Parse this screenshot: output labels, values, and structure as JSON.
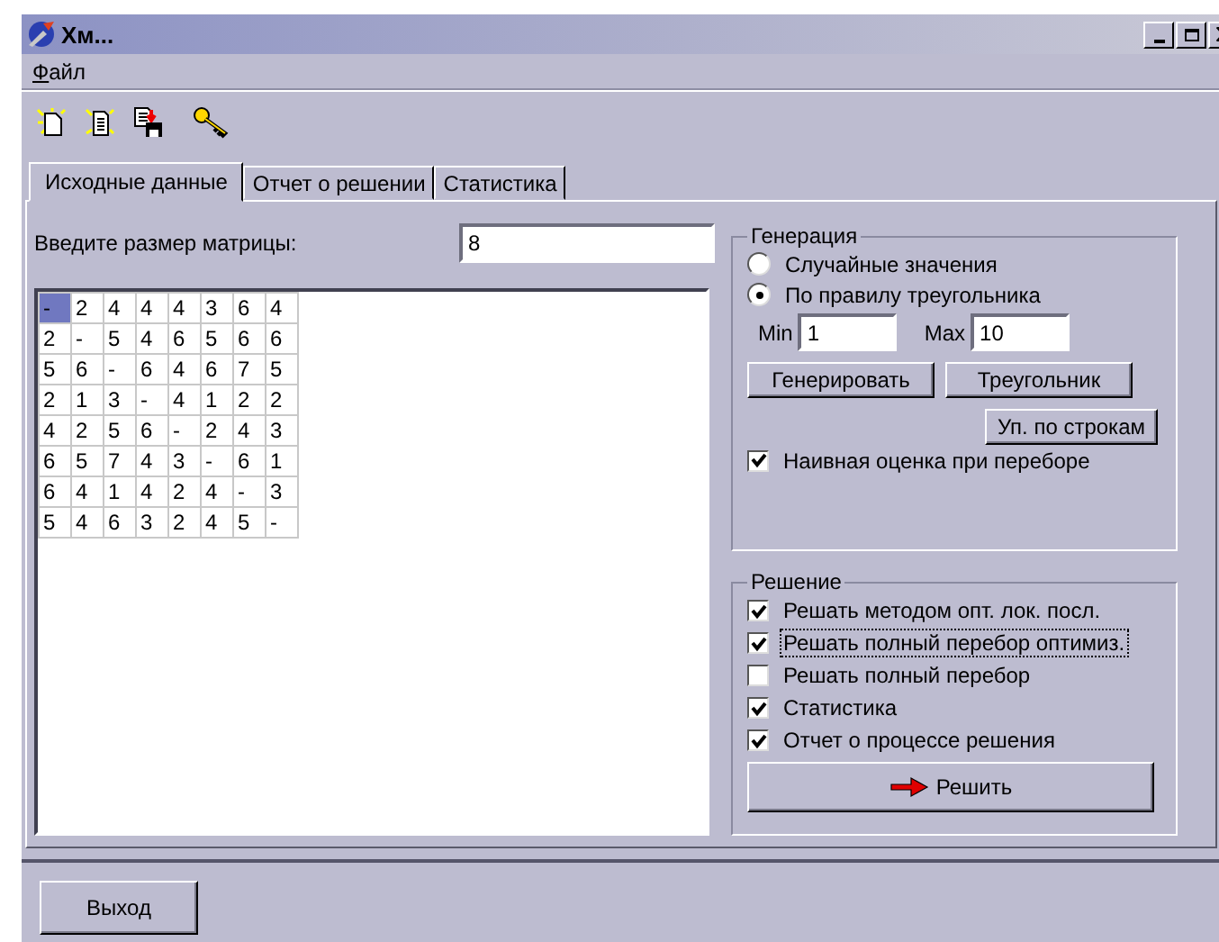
{
  "window": {
    "title": "Хм..."
  },
  "menu": [
    {
      "label": "Файл"
    }
  ],
  "tabs": [
    {
      "label": "Исходные данные",
      "selected": true
    },
    {
      "label": "Отчет о решении",
      "selected": false
    },
    {
      "label": "Статистика",
      "selected": false
    }
  ],
  "size_label": "Введите размер матрицы:",
  "size_field": {
    "value": "8"
  },
  "matrix": [
    {
      "cells": [
        {
          "text": "-",
          "selected": true
        },
        {
          "text": "2",
          "selected": false
        },
        {
          "text": "4",
          "selected": false
        },
        {
          "text": "4",
          "selected": false
        },
        {
          "text": "4",
          "selected": false
        },
        {
          "text": "3",
          "selected": false
        },
        {
          "text": "6",
          "selected": false
        },
        {
          "text": "4",
          "selected": false
        }
      ]
    },
    {
      "cells": [
        {
          "text": "2",
          "selected": false
        },
        {
          "text": "-",
          "selected": false
        },
        {
          "text": "5",
          "selected": false
        },
        {
          "text": "4",
          "selected": false
        },
        {
          "text": "6",
          "selected": false
        },
        {
          "text": "5",
          "selected": false
        },
        {
          "text": "6",
          "selected": false
        },
        {
          "text": "6",
          "selected": false
        }
      ]
    },
    {
      "cells": [
        {
          "text": "5",
          "selected": false
        },
        {
          "text": "6",
          "selected": false
        },
        {
          "text": "-",
          "selected": false
        },
        {
          "text": "6",
          "selected": false
        },
        {
          "text": "4",
          "selected": false
        },
        {
          "text": "6",
          "selected": false
        },
        {
          "text": "7",
          "selected": false
        },
        {
          "text": "5",
          "selected": false
        }
      ]
    },
    {
      "cells": [
        {
          "text": "2",
          "selected": false
        },
        {
          "text": "1",
          "selected": false
        },
        {
          "text": "3",
          "selected": false
        },
        {
          "text": "-",
          "selected": false
        },
        {
          "text": "4",
          "selected": false
        },
        {
          "text": "1",
          "selected": false
        },
        {
          "text": "2",
          "selected": false
        },
        {
          "text": "2",
          "selected": false
        }
      ]
    },
    {
      "cells": [
        {
          "text": "4",
          "selected": false
        },
        {
          "text": "2",
          "selected": false
        },
        {
          "text": "5",
          "selected": false
        },
        {
          "text": "6",
          "selected": false
        },
        {
          "text": "-",
          "selected": false
        },
        {
          "text": "2",
          "selected": false
        },
        {
          "text": "4",
          "selected": false
        },
        {
          "text": "3",
          "selected": false
        }
      ]
    },
    {
      "cells": [
        {
          "text": "6",
          "selected": false
        },
        {
          "text": "5",
          "selected": false
        },
        {
          "text": "7",
          "selected": false
        },
        {
          "text": "4",
          "selected": false
        },
        {
          "text": "3",
          "selected": false
        },
        {
          "text": "-",
          "selected": false
        },
        {
          "text": "6",
          "selected": false
        },
        {
          "text": "1",
          "selected": false
        }
      ]
    },
    {
      "cells": [
        {
          "text": "6",
          "selected": false
        },
        {
          "text": "4",
          "selected": false
        },
        {
          "text": "1",
          "selected": false
        },
        {
          "text": "4",
          "selected": false
        },
        {
          "text": "2",
          "selected": false
        },
        {
          "text": "4",
          "selected": false
        },
        {
          "text": "-",
          "selected": false
        },
        {
          "text": "3",
          "selected": false
        }
      ]
    },
    {
      "cells": [
        {
          "text": "5",
          "selected": false
        },
        {
          "text": "4",
          "selected": false
        },
        {
          "text": "6",
          "selected": false
        },
        {
          "text": "3",
          "selected": false
        },
        {
          "text": "2",
          "selected": false
        },
        {
          "text": "4",
          "selected": false
        },
        {
          "text": "5",
          "selected": false
        },
        {
          "text": "-",
          "selected": false
        }
      ]
    }
  ],
  "generation": {
    "title": "Генерация",
    "options": [
      {
        "label": "Случайные значения",
        "selected": false
      },
      {
        "label": "По правилу треугольника",
        "selected": true
      }
    ],
    "min": {
      "label": "Min",
      "value": "1"
    },
    "max": {
      "label": "Max",
      "value": "10"
    },
    "buttons": [
      "Генерировать",
      "Треугольник",
      "Уп. по строкам"
    ],
    "naive": {
      "label": "Наивная оценка при переборе",
      "checked": true
    }
  },
  "solution": {
    "title": "Решение",
    "options": [
      {
        "label": "Решать методом опт. лок. посл.",
        "checked": true,
        "focused": false
      },
      {
        "label": "Решать полный перебор оптимиз.",
        "checked": true,
        "focused": true
      },
      {
        "label": "Решать полный перебор",
        "checked": false,
        "focused": false
      },
      {
        "label": "Статистика",
        "checked": true,
        "focused": false
      },
      {
        "label": "Отчет о процессе решения",
        "checked": true,
        "focused": false
      }
    ],
    "solve_button": "Решить"
  },
  "exit_button": "Выход"
}
